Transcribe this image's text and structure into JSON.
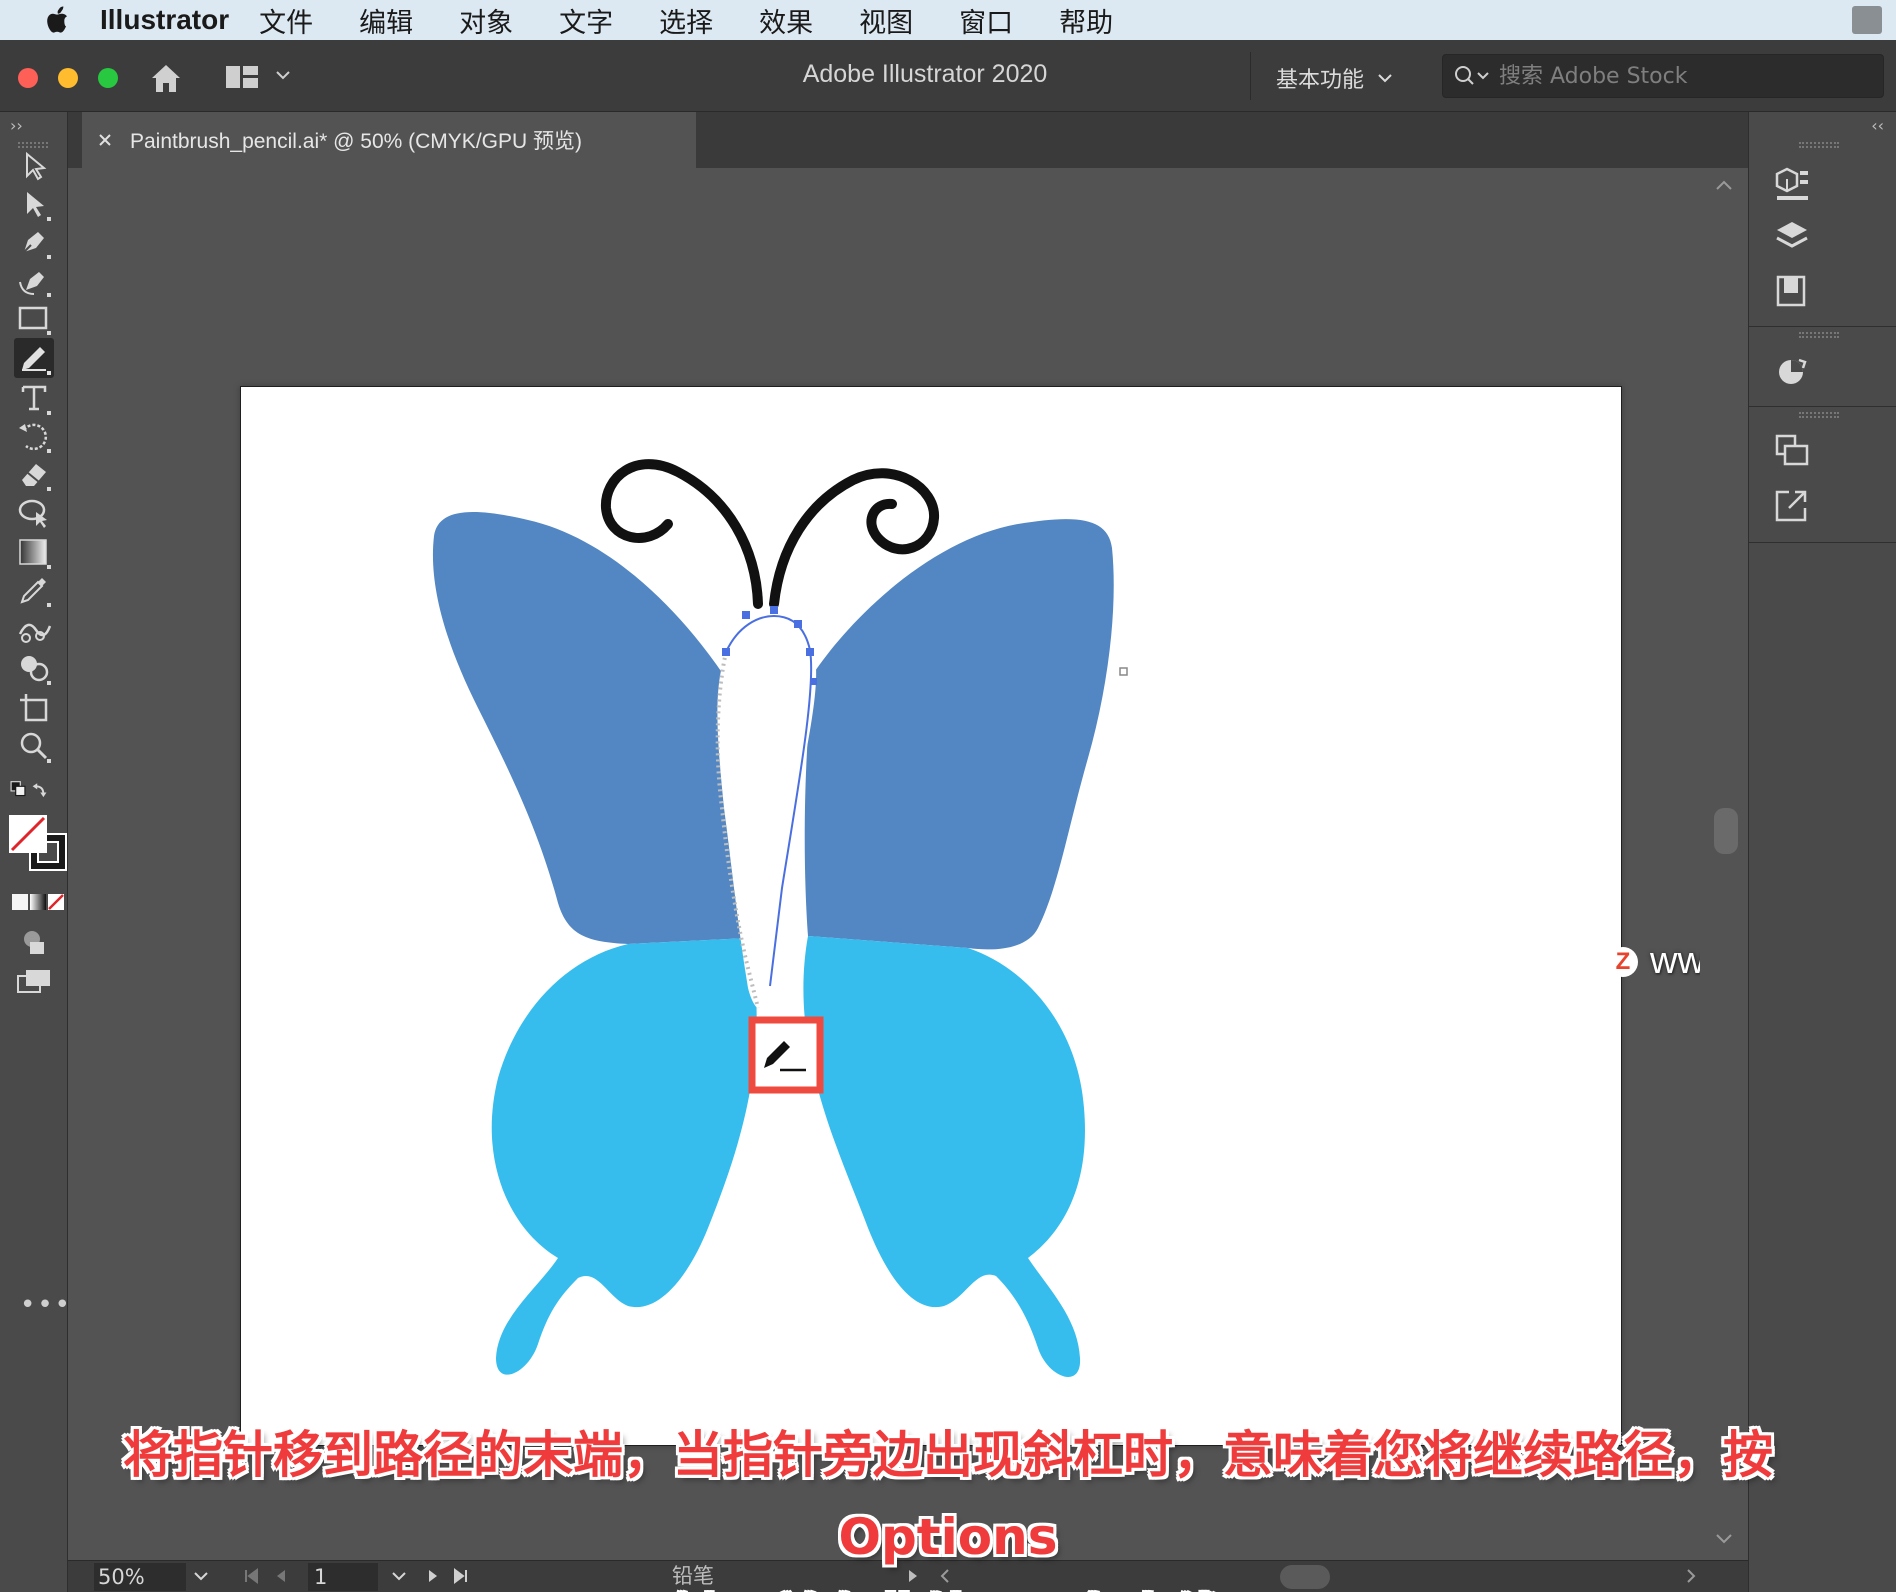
{
  "menubar": {
    "app_name": "Illustrator",
    "items": [
      "文件",
      "编辑",
      "对象",
      "文字",
      "选择",
      "效果",
      "视图",
      "窗口",
      "帮助"
    ]
  },
  "titlebar": {
    "title": "Adobe Illustrator 2020",
    "workspace": "基本功能",
    "stock_search_placeholder": "搜索 Adobe Stock"
  },
  "document_tab": {
    "label": "Paintbrush_pencil.ai* @ 50% (CMYK/GPU 预览)"
  },
  "toolbar": {
    "tools": [
      {
        "name": "selection-tool",
        "icon": "arrow-outline-icon"
      },
      {
        "name": "direct-selection-tool",
        "icon": "arrow-solid-icon"
      },
      {
        "name": "pen-tool",
        "icon": "pen-nib-icon"
      },
      {
        "name": "curvature-tool",
        "icon": "curvature-pen-icon"
      },
      {
        "name": "rectangle-tool",
        "icon": "rectangle-icon"
      },
      {
        "name": "pencil-tool",
        "icon": "pencil-icon",
        "active": true
      },
      {
        "name": "type-tool",
        "icon": "type-t-icon"
      },
      {
        "name": "rotate-tool",
        "icon": "rotate-icon"
      },
      {
        "name": "eraser-tool",
        "icon": "eraser-icon"
      },
      {
        "name": "puppet-warp-tool",
        "icon": "warp-icon"
      },
      {
        "name": "gradient-tool",
        "icon": "gradient-icon"
      },
      {
        "name": "eyedropper-tool",
        "icon": "eyedropper-icon"
      },
      {
        "name": "blend-tool",
        "icon": "blend-icon"
      },
      {
        "name": "shape-builder-tool",
        "icon": "shape-builder-icon"
      },
      {
        "name": "artboard-tool",
        "icon": "artboard-icon"
      },
      {
        "name": "zoom-tool",
        "icon": "magnifier-icon"
      }
    ]
  },
  "colors": {
    "wing_upper": "#5287c4",
    "wing_lower": "#36bdee",
    "antenna": "#111111",
    "path_selection": "#4a6fe0",
    "highlight_box": "#ef4a3f",
    "caption": "#ef3b3b"
  },
  "statusbar": {
    "zoom": "50%",
    "page": "1",
    "tool_name": "铅笔"
  },
  "watermark": {
    "badge": "Z",
    "url": "www.MacZ.com"
  },
  "caption": {
    "line1": "将指针移到路径的末端，当指针旁边出现斜杠时，意味着您将继续路径，按 Options",
    "line2": "键，并在此处画一条直线"
  }
}
